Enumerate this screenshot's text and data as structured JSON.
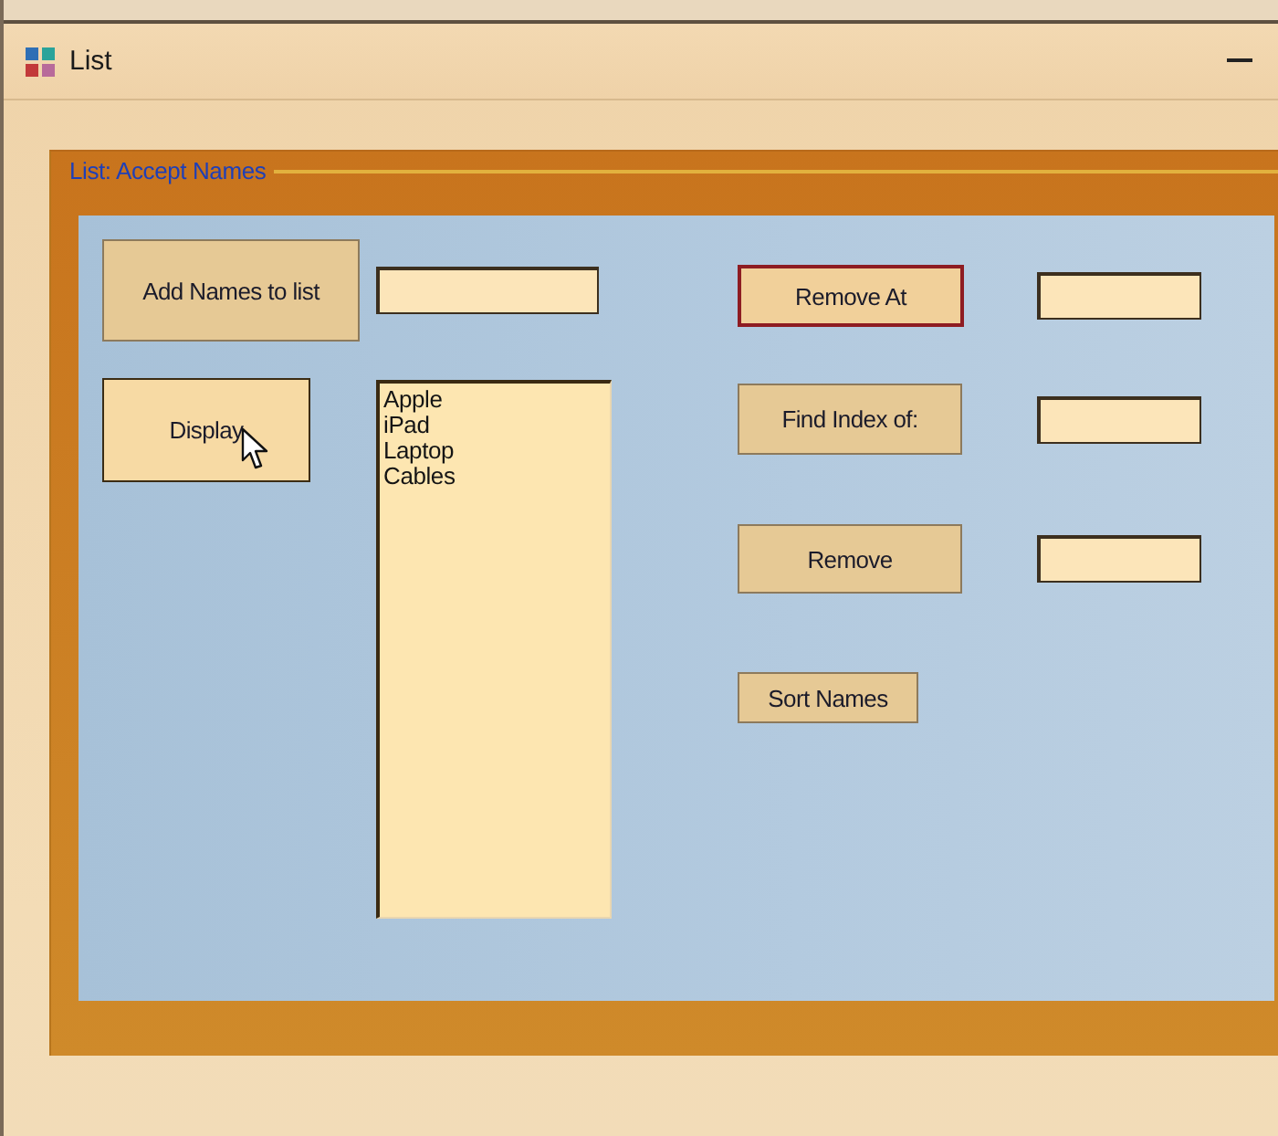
{
  "window": {
    "title": "List"
  },
  "group": {
    "title": "List: Accept Names"
  },
  "left_rows": [
    {
      "kind": "field",
      "button": {
        "label": "Add Names to list",
        "focused": false,
        "hovered": false
      }
    },
    {
      "kind": "list",
      "button": {
        "label": "Display",
        "focused": false,
        "hovered": true
      },
      "items": [
        "Apple",
        "iPad",
        "Laptop",
        "Cables"
      ]
    }
  ],
  "right_rows": [
    {
      "kind": "field",
      "button": {
        "label": "Remove At",
        "focused": true,
        "hovered": false
      }
    },
    {
      "kind": "field",
      "button": {
        "label": "Find Index of:",
        "focused": false,
        "hovered": false
      }
    },
    {
      "kind": "field",
      "button": {
        "label": "Remove",
        "focused": false,
        "hovered": false
      }
    },
    {
      "kind": "button",
      "button": {
        "label": "Sort Names",
        "focused": false,
        "hovered": false
      }
    }
  ]
}
